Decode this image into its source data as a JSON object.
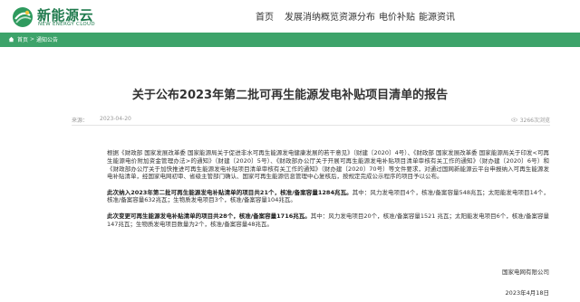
{
  "brand": {
    "cn": "新能源云",
    "en": "NEW ENERGY CLOUD",
    "color": "#1f7a4d"
  },
  "nav": {
    "items": [
      {
        "label": "首页"
      },
      {
        "label": "发展消纳概览"
      },
      {
        "label": "资源分布"
      },
      {
        "label": "电价补贴"
      },
      {
        "label": "能源资讯"
      }
    ]
  },
  "breadcrumb": {
    "items": [
      "首页",
      "通知公告"
    ],
    "separator": ">",
    "bar_color": "#3da36a"
  },
  "article": {
    "title": "关于公布2023年第二批可再生能源发电补贴项目清单的报告",
    "source": "来源：",
    "date": "2023-04-20",
    "views": "3266次浏览",
    "para1": "根据《财政部 国家发展改革委 国家能源局关于促进非水可再生能源发电健康发展的若干意见》（财建〔2020〕4号）、《财政部 国家发展改革委 国家能源局关于印发<可再生能源电价附加资金管理办法>的通知》（财建〔2020〕5号）、《财政部办公厅关于开展可再生能源发电补贴项目清单审核有关工作的通知》（财办建〔2020〕6号）和《财政部办公厅关于加快推进可再生能源发电补贴项目清单审核有关工作的通知》（财办建〔2020〕70号）等文件要求，对通过国网新能源云平台申报纳入可再生能源发电补贴清单，经国家电网初审、省级主管部门确认、国家可再生能源信息管理中心复核后，按规定完成公示程序的项目予以公布。",
    "para2_bold": "此次纳入2023年第二批可再生能源发电补贴清单的项目共21个，核准/备案容量1284兆瓦。",
    "para2_rest": "其中：风力发电项目4个，核准/备案容量548兆瓦；太阳能发电项目14个，核准/备案容量632兆瓦；生物质发电项目3个，核准/备案容量104兆瓦。",
    "para3_bold": "此次变更可再生能源发电补贴清单的项目共28个，核准/备案容量1716兆瓦。",
    "para3_rest": "其中：风力发电项目20个，核准/备案容量1521 兆瓦；太阳能发电项目6个，核准/备案容量147兆瓦；生物质发电项目数量为2个，核准/备案容量48兆瓦。",
    "signature": "国家电网有限公司",
    "sign_date": "2023年4月18日"
  }
}
